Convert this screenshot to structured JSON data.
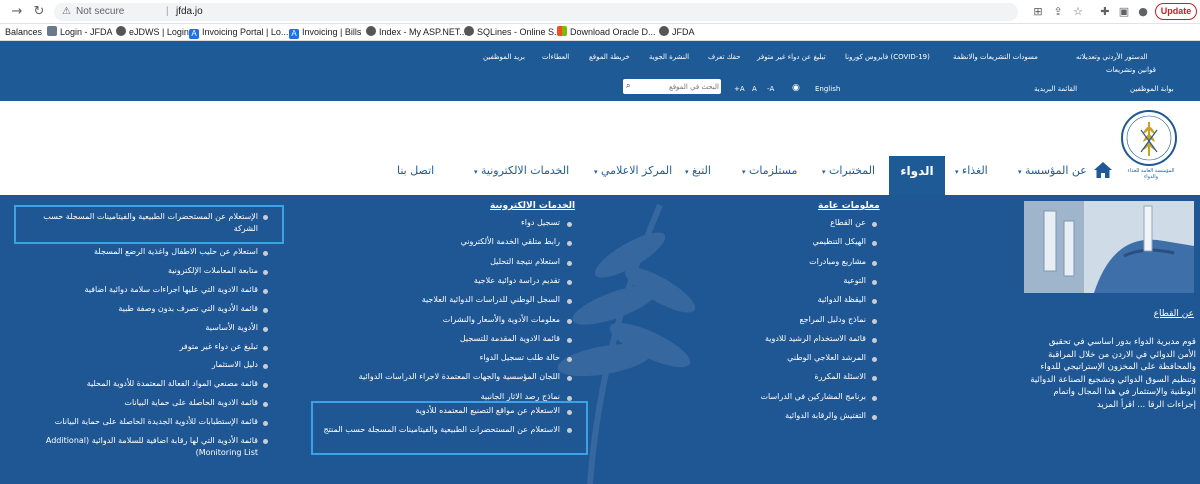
{
  "browser": {
    "security_label": "Not secure",
    "url": "jfda.jo",
    "update_label": "Update"
  },
  "bookmarks": [
    {
      "label": "Balances"
    },
    {
      "label": "Login - JFDA"
    },
    {
      "label": "eJDWS | Login"
    },
    {
      "label": "Invoicing Portal | Lo..."
    },
    {
      "label": "Invoicing | Bills"
    },
    {
      "label": "Index - My ASP.NET..."
    },
    {
      "label": "SQLines - Online S..."
    },
    {
      "label": "Download Oracle D..."
    },
    {
      "label": "JFDA"
    }
  ],
  "top_links": {
    "constitution": "الدستور الأردني وتعديلاته",
    "legislation": "مسودات التشريعات والانظمة",
    "covid": "(COVID-19) فايروس كورونا",
    "report_missing": "تبليغ عن دواء غير متوفر",
    "your_right": "حقك تعرف",
    "bulletin": "النشرة الجوية",
    "sitemap": "خريطة الموقع",
    "tenders": "العطاءات",
    "staff_mail": "بريد الموظفين",
    "laws": "قوانين وتشريعات"
  },
  "utility": {
    "staff_portal": "بوابة الموظفين",
    "mailing_list": "القائمة البريدية",
    "english": "English",
    "font_smaller": "A-",
    "font_normal": "A",
    "font_larger": "A+",
    "search_placeholder": "البحث في الموقع"
  },
  "logo_text": "المؤسسة العامة للغذاء والدواء",
  "main_nav": {
    "about": "عن المؤسسة",
    "food": "الغذاء",
    "drug": "الدواء",
    "labs": "المختبرات",
    "supplies": "مستلزمات",
    "tobacco": "التبغ",
    "media": "المركز الاعلامي",
    "eservices": "الخدمات الالكترونية",
    "contact": "اتصل بنا"
  },
  "mega": {
    "general_title": "معلومات عامة",
    "general_items": [
      "عن القطاع",
      "الهيكل التنظيمي",
      "مشاريع ومبادرات",
      "التوعية",
      "اليقظة الدوائية",
      "نماذج ودليل المراجع",
      "قائمة الاستخدام الرشيد للادوية",
      "المرشد العلاجي الوطني",
      "الاسئلة المكررة",
      "برنامج المشاركين في الدراسات",
      "التفتيش والرقابة الدوائية"
    ],
    "eservices_title": "الخدمات الالكترونية",
    "eservices_items": [
      "تسجيل دواء",
      "رابط متلقي الخدمة الألكتروني",
      "استعلام نتيجة التحليل",
      "تقديم دراسة دوائية علاجية",
      "السجل الوطني للدراسات الدوائية العلاجية",
      "معلومات الأدوية والأسعار والنشرات",
      "قائمة الادوية المقدمة للتسجيل",
      "حالة طلب تسجيل الدواء",
      "اللجان المؤسسية والجهات المعتمدة لاجراء الدراسات الدوائية",
      "نماذج رصد الاثار الجانبية",
      "الاستعلام عن مواقع التصنيع المعتمده للأدوية",
      "الاستعلام عن المستحضرات الطبيعية والفيتامينات المسجلة حسب المنتج"
    ],
    "third_items": [
      "الإستعلام عن المستحضرات الطبيعية والفيتامينات المسجلة حسب الشركة",
      "استعلام عن حليب الاطفال واغذية الرضع المسجلة",
      "متابعة المعاملات الإلكترونية",
      "قائمة الادوية التي عليها اجراءات سلامة دوائية اضافية",
      "قائمة الأدوية التي تصرف بدون وصفة طبية",
      "الأدوية الأساسية",
      "تبليغ عن دواء غير متوفر",
      "دليل الاستثمار",
      "قائمة مصنعي المواد الفعالة المعتمدة للأدوية المحلية",
      "قائمة الادوية الحاصلة على حماية البيانات",
      "قائمة الإستطبابات للأدوية الجديدة الحاصلة على حماية البيانات",
      "قائمة الأدوية التي لها رقابة اضافية للسلامة الدوائية (Additional Monitoring List)"
    ],
    "side_heading": "عن القطاع",
    "side_paragraph": "قوم مديرية الدواء بدور اساسي في تحقيق الأمن الدوائي في الاردن من خلال المراقبة والمحافظة على المخزون الإستراتيجي للدواء وتنظيم السوق الدوائي وتشجيع الصناعة الدوائية الوطنية والإستثمار في هذا المجال واتمام إجراءات الرقا ... اقرأ المزيد"
  }
}
